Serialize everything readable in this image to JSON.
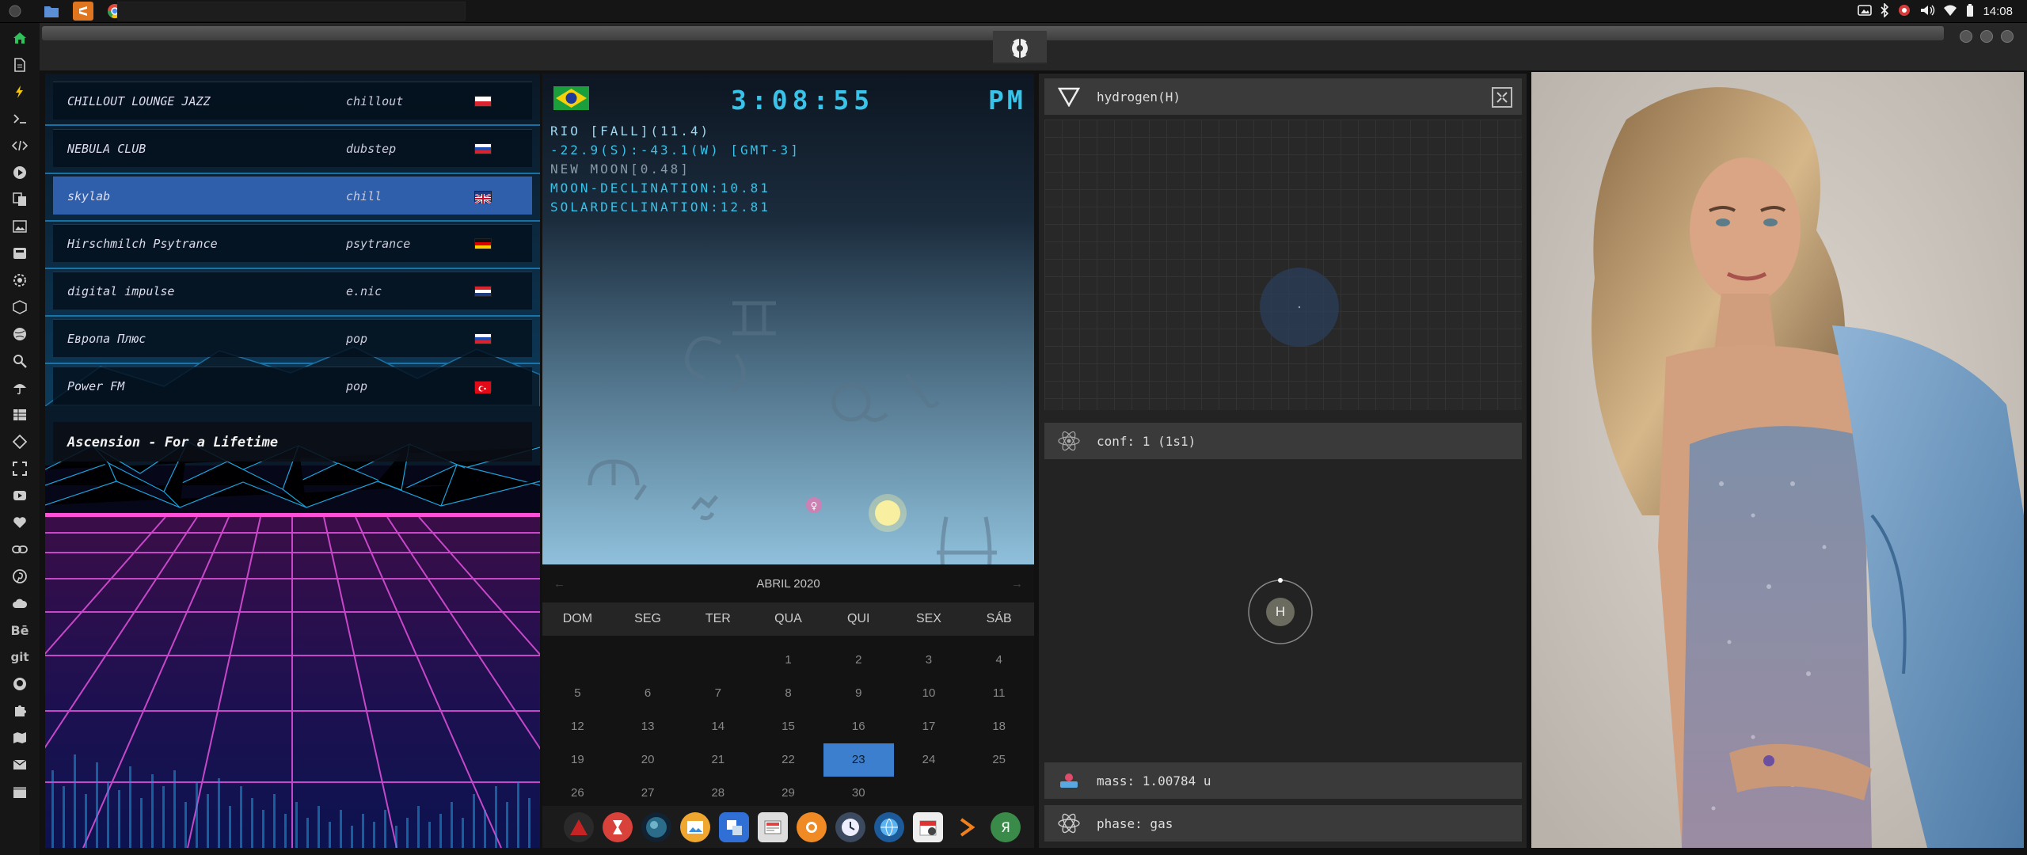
{
  "taskbar": {
    "apps": [
      {
        "name": "system-icon"
      },
      {
        "name": "files-icon"
      },
      {
        "name": "sublime-text-icon"
      },
      {
        "name": "chrome-icon"
      }
    ],
    "clock": "14:08"
  },
  "sidebar": {
    "icons": [
      "home-icon",
      "document-icon",
      "bolt-icon",
      "terminal-icon",
      "code-icon",
      "play-icon",
      "files-icon",
      "image-icon",
      "music-icon",
      "settings-icon",
      "box-icon",
      "globe-icon",
      "search-icon",
      "umbrella-icon",
      "table-icon",
      "tag-icon",
      "expand-icon",
      "youtube-icon",
      "heart-icon",
      "link-icon",
      "pinterest-icon",
      "cloud-icon",
      "behance-icon",
      "git-icon",
      "github-icon",
      "puzzle-icon",
      "map-icon",
      "mail-icon",
      "calendar-icon"
    ],
    "text_icons": {
      "behance": "Bē",
      "git": "git"
    }
  },
  "radio": {
    "stations": [
      {
        "name": "CHILLOUT LOUNGE JAZZ",
        "genre": "chillout",
        "flag": [
          "#ffffff",
          "#d9232e",
          "#d9232e"
        ]
      },
      {
        "name": "NEBULA CLUB",
        "genre": "dubstep",
        "flag": [
          "#ffffff",
          "#1e4fb4",
          "#d9232e"
        ]
      },
      {
        "name": "skylab",
        "genre": "chill",
        "flag": [
          "#1e3a80",
          "#ffffff",
          "#c8102e"
        ]
      },
      {
        "name": "Hirschmilch Psytrance",
        "genre": "psytrance",
        "flag": [
          "#111111",
          "#dd0000",
          "#ffcc00"
        ]
      },
      {
        "name": "digital impulse",
        "genre": "e.nic",
        "flag": [
          "#d9232e",
          "#ffffff",
          "#1e3a80"
        ]
      },
      {
        "name": "Европа Плюс",
        "genre": "pop",
        "flag": [
          "#ffffff",
          "#1e4fb4",
          "#d9232e"
        ]
      },
      {
        "name": "Power FM",
        "genre": "pop",
        "flag": [
          "#e30a17",
          "#e30a17",
          "#e30a17"
        ]
      }
    ],
    "active_index": 2,
    "now_playing": "Ascension - For a Lifetime"
  },
  "astro": {
    "time": "3:08:55",
    "ampm": "PM",
    "lines": [
      {
        "text": "RIO [FALL](11.4)",
        "color": "#9fd8ee"
      },
      {
        "text": "-22.9(S):-43.1(W) [GMT-3]",
        "color": "#39c3e8"
      },
      {
        "text": "NEW MOON[0.48]",
        "color": "#8a9aa6"
      },
      {
        "text": "MOON-DECLINATION:10.81",
        "color": "#39c3e8"
      },
      {
        "text": "SOLARDECLINATION:12.81",
        "color": "#39c3e8"
      }
    ]
  },
  "calendar": {
    "month": "ABRIL 2020",
    "days": [
      "DOM",
      "SEG",
      "TER",
      "QUA",
      "QUI",
      "SEX",
      "SÁB"
    ],
    "weeks": [
      [
        "",
        "",
        "",
        "1",
        "2",
        "3",
        "4"
      ],
      [
        "5",
        "6",
        "7",
        "8",
        "9",
        "10",
        "11"
      ],
      [
        "12",
        "13",
        "14",
        "15",
        "16",
        "17",
        "18"
      ],
      [
        "19",
        "20",
        "21",
        "22",
        "23",
        "24",
        "25"
      ],
      [
        "26",
        "27",
        "28",
        "29",
        "30",
        "",
        ""
      ]
    ],
    "selected": "23"
  },
  "element": {
    "title": "hydrogen(H)",
    "conf": "conf: 1 (1s1)",
    "symbol": "H",
    "mass": "mass: 1.00784 u",
    "phase": "phase: gas"
  },
  "colors": {
    "accent": "#39c3e8",
    "selected_station": "#2f5faa",
    "calendar_selected": "#3d7fcf"
  }
}
